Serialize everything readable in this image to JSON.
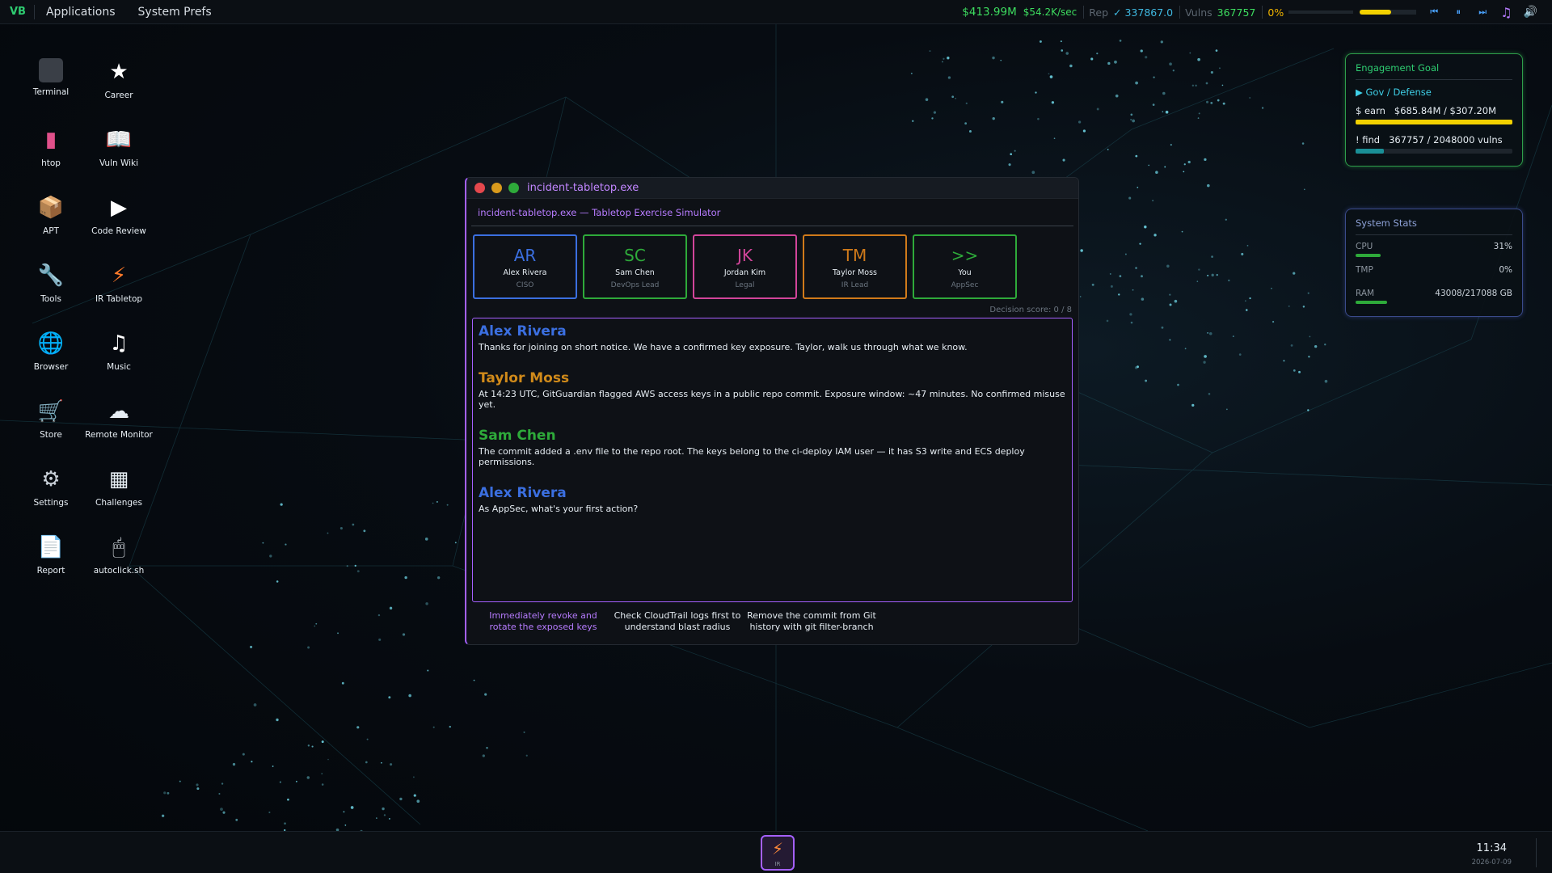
{
  "topbar": {
    "logo": "VB",
    "menus": [
      "Applications",
      "System Prefs"
    ],
    "money": "$413.99M",
    "rate": "$54.2K/sec",
    "rep_label": "Rep",
    "rep_value": "✓ 337867.0",
    "vulns_label": "Vulns",
    "vulns_value": "367757",
    "heat_percent": "0%",
    "heat_level": 0.55
  },
  "desktop_icons": [
    {
      "label": "Terminal",
      "icon": "terminal-icon",
      "glyph": "▪"
    },
    {
      "label": "Career",
      "icon": "star-icon",
      "glyph": "★"
    },
    {
      "label": "htop",
      "icon": "chart-icon",
      "glyph": "▮"
    },
    {
      "label": "Vuln Wiki",
      "icon": "book-icon",
      "glyph": "📖"
    },
    {
      "label": "APT",
      "icon": "package-icon",
      "glyph": "📦"
    },
    {
      "label": "Code Review",
      "icon": "play-icon",
      "glyph": "▶"
    },
    {
      "label": "Tools",
      "icon": "wrench-icon",
      "glyph": "🔧"
    },
    {
      "label": "IR Tabletop",
      "icon": "bolt-icon",
      "glyph": "⚡"
    },
    {
      "label": "Browser",
      "icon": "globe-icon",
      "glyph": "🌐"
    },
    {
      "label": "Music",
      "icon": "music-icon",
      "glyph": "♫"
    },
    {
      "label": "Store",
      "icon": "cart-icon",
      "glyph": "🛒"
    },
    {
      "label": "Remote Monitor",
      "icon": "cloud-icon",
      "glyph": "☁"
    },
    {
      "label": "Settings",
      "icon": "gear-icon",
      "glyph": "⚙"
    },
    {
      "label": "Challenges",
      "icon": "checkered-flag-icon",
      "glyph": "▦"
    },
    {
      "label": "Report",
      "icon": "document-icon",
      "glyph": "📄"
    },
    {
      "label": "autoclick.sh",
      "icon": "mouse-icon",
      "glyph": "🖱"
    }
  ],
  "engagement_goal": {
    "title": "Engagement Goal",
    "category": "▶ Gov / Defense",
    "earn_label": "$  earn",
    "earn_value": "$685.84M / $307.20M",
    "earn_progress": 1.0,
    "find_label": "!  find",
    "find_value": "367757 / 2048000 vulns",
    "find_progress": 0.18
  },
  "system_stats": {
    "title": "System Stats",
    "cpu_label": "CPU",
    "cpu_value": "31%",
    "cpu_level": 0.16,
    "tmp_label": "TMP",
    "tmp_value": "0%",
    "tmp_level": 0,
    "ram_label": "RAM",
    "ram_value": "43008/217088 GB",
    "ram_level": 0.2
  },
  "window": {
    "title": "incident-tabletop.exe",
    "subtitle": "incident-tabletop.exe — Tabletop Exercise Simulator",
    "participants": [
      {
        "initials": "AR",
        "name": "Alex Rivera",
        "role": "CISO",
        "color": "#3b6fe0"
      },
      {
        "initials": "SC",
        "name": "Sam Chen",
        "role": "DevOps Lead",
        "color": "#2eaa3a"
      },
      {
        "initials": "JK",
        "name": "Jordan Kim",
        "role": "Legal",
        "color": "#d2459a"
      },
      {
        "initials": "TM",
        "name": "Taylor Moss",
        "role": "IR Lead",
        "color": "#d07a1a"
      },
      {
        "initials": ">>",
        "name": "You",
        "role": "AppSec",
        "color": "#2eaa3a"
      }
    ],
    "score": "Decision score: 0 / 8",
    "messages": [
      {
        "speaker": "Alex Rivera",
        "color": "#3b6fe0",
        "text": "Thanks for joining on short notice. We have a confirmed key exposure. Taylor, walk us through what we know."
      },
      {
        "speaker": "Taylor Moss",
        "color": "#d08a1a",
        "text": "At 14:23 UTC, GitGuardian flagged AWS access keys in a public repo commit. Exposure window: ~47 minutes. No confirmed misuse yet."
      },
      {
        "speaker": "Sam Chen",
        "color": "#2eaa3a",
        "text": "The commit added a .env file to the repo root. The keys belong to the ci-deploy IAM user — it has S3 write and ECS deploy permissions."
      },
      {
        "speaker": "Alex Rivera",
        "color": "#3b6fe0",
        "text": "As AppSec, what's your first action?"
      }
    ],
    "actions": [
      {
        "line1": "Immediately revoke and",
        "line2": "rotate the exposed keys"
      },
      {
        "line1": "Check CloudTrail logs first to",
        "line2": "understand blast radius"
      },
      {
        "line1": "Remove the commit from Git",
        "line2": "history with git filter-branch"
      }
    ]
  },
  "dock": {
    "app_label": "IR",
    "clock": "11:34",
    "date": "2026-07-09"
  }
}
